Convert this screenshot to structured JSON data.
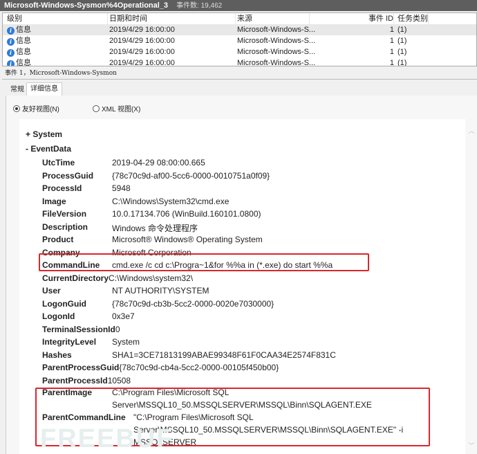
{
  "window": {
    "title": "Microsoft-Windows-Sysmon%4Operational_3",
    "event_count": "事件数: 19,462"
  },
  "list": {
    "columns": [
      "级别",
      "日期和时间",
      "来源",
      "事件 ID",
      "任务类别"
    ],
    "rows": [
      {
        "level": "信息",
        "datetime": "2019/4/29 16:00:00",
        "source": "Microsoft-Windows-S...",
        "id": "1",
        "task": "(1)"
      },
      {
        "level": "信息",
        "datetime": "2019/4/29 16:00:00",
        "source": "Microsoft-Windows-S...",
        "id": "1",
        "task": "(1)"
      },
      {
        "level": "信息",
        "datetime": "2019/4/29 16:00:00",
        "source": "Microsoft-Windows-S...",
        "id": "1",
        "task": "(1)"
      },
      {
        "level": "信息",
        "datetime": "2019/4/29 16:00:00",
        "source": "Microsoft-Windows-S...",
        "id": "1",
        "task": "(1)"
      }
    ]
  },
  "event_header": "事件 1，Microsoft-Windows-Sysmon",
  "tabs": [
    "常规",
    "详细信息"
  ],
  "views": {
    "friendly": "友好视图(N)",
    "xml": "XML 视图(X)",
    "selected": "friendly"
  },
  "tree": {
    "system": "+ System",
    "eventdata": "- EventData"
  },
  "fields": [
    {
      "k": "UtcTime",
      "v": "2019-04-29 08:00:00.665"
    },
    {
      "k": "ProcessGuid",
      "v": "{78c70c9d-af00-5cc6-0000-0010751a0f09}"
    },
    {
      "k": "ProcessId",
      "v": "5948"
    },
    {
      "k": "Image",
      "v": "C:\\Windows\\System32\\cmd.exe"
    },
    {
      "k": "FileVersion",
      "v": "10.0.17134.706 (WinBuild.160101.0800)"
    },
    {
      "k": "Description",
      "v": "Windows 命令处理程序"
    },
    {
      "k": "Product",
      "v": "Microsoft® Windows® Operating System"
    },
    {
      "k": "Company",
      "v": "Microsoft Corporation"
    },
    {
      "k": "CommandLine",
      "v": "cmd.exe /c cd c:\\Progra~1&for %%a in (*.exe) do start %%a"
    },
    {
      "k": "CurrentDirectory",
      "v": "C:\\Windows\\system32\\"
    },
    {
      "k": "User",
      "v": "NT AUTHORITY\\SYSTEM"
    },
    {
      "k": "LogonGuid",
      "v": "{78c70c9d-cb3b-5cc2-0000-0020e7030000}"
    },
    {
      "k": "LogonId",
      "v": "0x3e7"
    },
    {
      "k": "TerminalSessionId",
      "v": "0"
    },
    {
      "k": "IntegrityLevel",
      "v": "System"
    },
    {
      "k": "Hashes",
      "v": "SHA1=3CE71813199ABAE99348F61F0CAA34E2574F831C"
    },
    {
      "k": "ParentProcessGuid",
      "v": "{78c70c9d-cb4a-5cc2-0000-00105f450b00}"
    },
    {
      "k": "ParentProcessId",
      "v": "10508"
    }
  ],
  "parent_image": {
    "k": "ParentImage",
    "v1": "C:\\Program Files\\Microsoft SQL",
    "v2": "Server\\MSSQL10_50.MSSQLSERVER\\MSSQL\\Binn\\SQLAGENT.EXE"
  },
  "parent_cmd": {
    "k": "ParentCommandLine",
    "v1": "\"C:\\Program Files\\Microsoft SQL",
    "v2": "Server\\MSSQL10_50.MSSQLSERVER\\MSSQL\\Binn\\SQLAGENT.EXE\" -i",
    "v3": "MSSQLSERVER"
  },
  "watermark": "FREEBUF",
  "colors": {
    "highlight": "#d9262c",
    "titlebar": "#5e5e5e",
    "info_icon": "#2f7bd6"
  }
}
